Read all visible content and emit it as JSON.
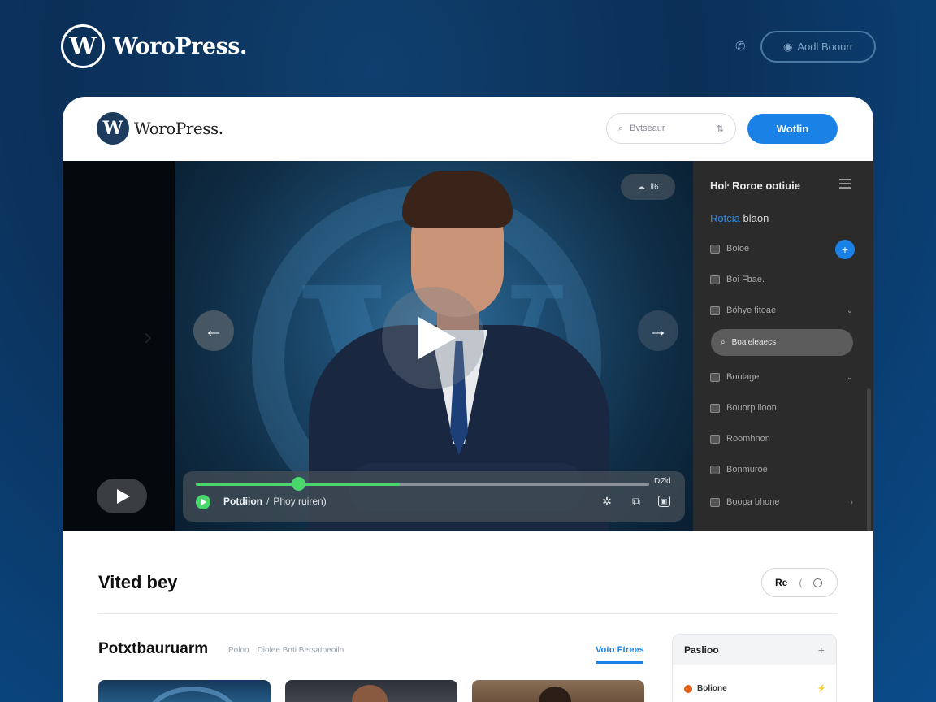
{
  "topbar": {
    "logo_glyph": "W",
    "brand": "WoroPress.",
    "phone_icon": "phone-icon",
    "account_button": "Aodl Boourr",
    "account_icon": "user-circle-icon"
  },
  "card_header": {
    "logo_glyph": "W",
    "brand": "WoroPress.",
    "search_placeholder": "Bvtseaur",
    "search_icon": "search-icon",
    "filter_icon": "filter-icon",
    "primary_button": "Wotlin"
  },
  "video": {
    "hd_label": "Ⅱ6",
    "progress": 0.45,
    "duration": "DØd",
    "title": "Potdiion",
    "separator": "/",
    "subtitle": "Phoy ruiren)",
    "accent_color": "#49d66a"
  },
  "side_panel": {
    "title": "Hoŀ Roroe ootiuie",
    "active_accent": "Rotcia",
    "active_rest": "blaon",
    "items": [
      {
        "label": "Boloe",
        "top": 0
      },
      {
        "label": "Boi Fbae.",
        "top": 0
      },
      {
        "label": "Böhye fitoae",
        "top": 0
      },
      {
        "label": "Boolage",
        "top": 0
      },
      {
        "label": "Bouorp lloon",
        "top": 0
      },
      {
        "label": "Roomhnon",
        "top": 0
      },
      {
        "label": "Bonmuroe",
        "top": 0
      },
      {
        "label": "Boopa bhone",
        "top": 0
      }
    ],
    "search_value": "Boaieleaecs"
  },
  "content": {
    "section_title": "Vited bey",
    "section_pill": "Re",
    "section_pill_bar": "(",
    "subtitle": "Potxtbauruarm",
    "meta_1": "Poloo",
    "meta_2": "Diolee Boti Bersatoeoiln",
    "link": "Voto Ftrees",
    "right_box_title": "Paslioo",
    "right_box_plus": "+",
    "right_box_row": "Bolione"
  }
}
